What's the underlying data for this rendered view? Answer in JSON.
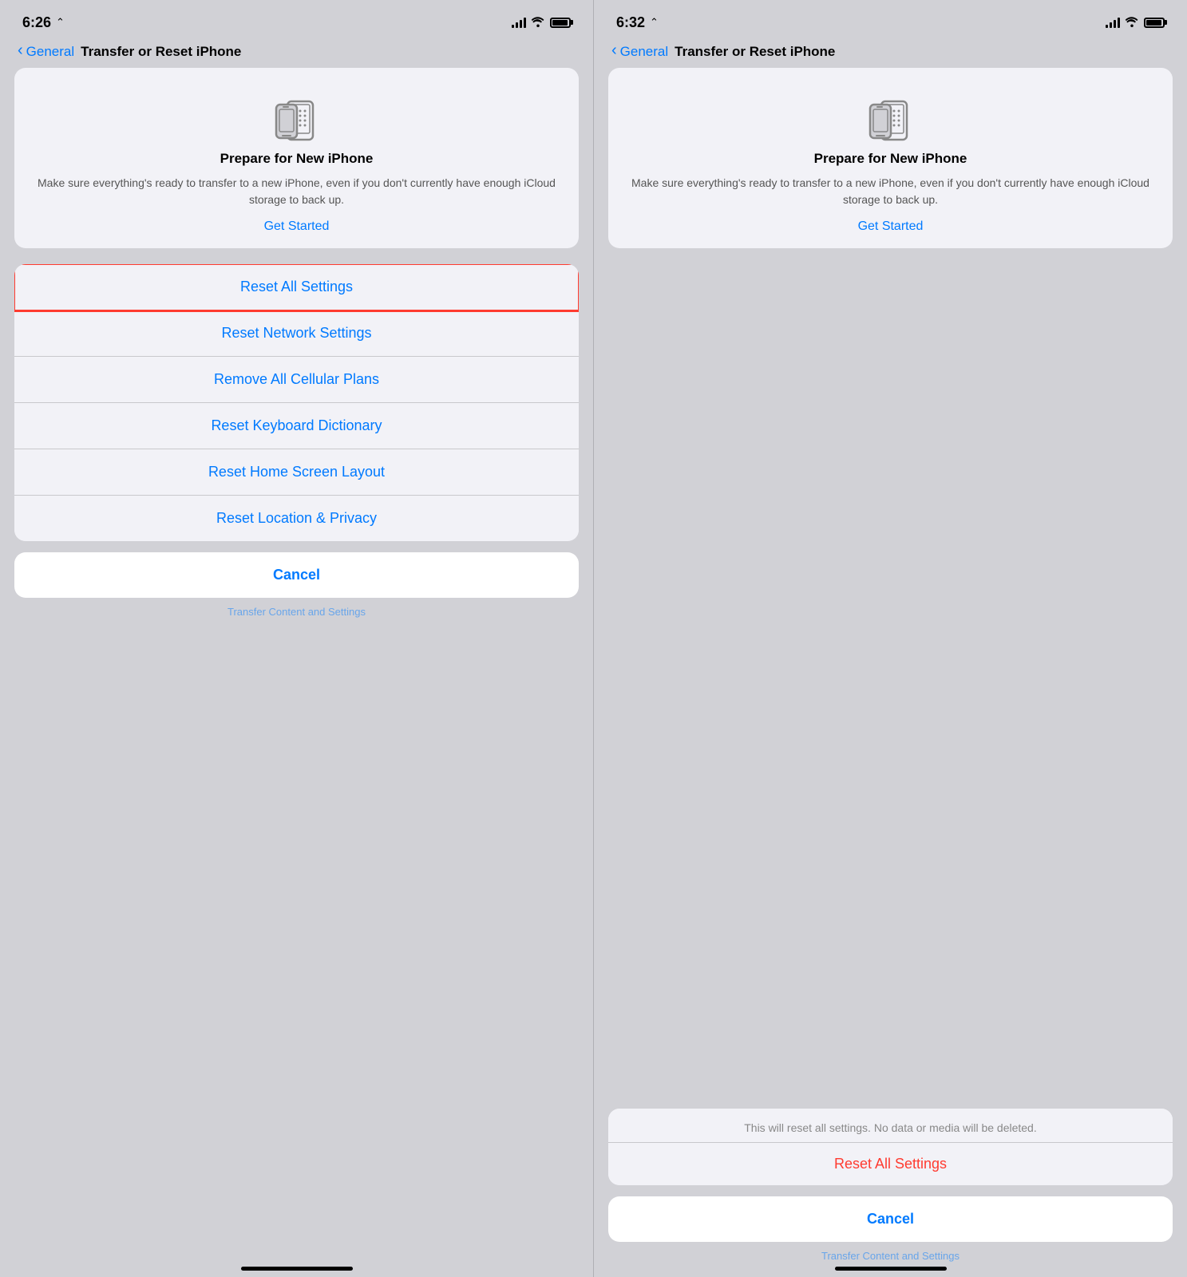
{
  "left_panel": {
    "status": {
      "time": "6:26",
      "location_icon": "◂",
      "signal": true,
      "wifi": true,
      "battery": true
    },
    "nav": {
      "back_label": "General",
      "title": "Transfer or Reset iPhone"
    },
    "prepare_card": {
      "title": "Prepare for New iPhone",
      "description": "Make sure everything's ready to transfer to a new iPhone, even if you don't currently have enough iCloud storage to back up.",
      "cta": "Get Started"
    },
    "reset_items": [
      {
        "label": "Reset All Settings",
        "highlighted": true
      },
      {
        "label": "Reset Network Settings",
        "highlighted": false
      },
      {
        "label": "Remove All Cellular Plans",
        "highlighted": false
      },
      {
        "label": "Reset Keyboard Dictionary",
        "highlighted": false
      },
      {
        "label": "Reset Home Screen Layout",
        "highlighted": false
      },
      {
        "label": "Reset Location & Privacy",
        "highlighted": false
      }
    ],
    "cancel_label": "Cancel",
    "bottom_fade": "Transfer Content and Settings"
  },
  "right_panel": {
    "status": {
      "time": "6:32",
      "location_icon": "◂",
      "signal": true,
      "wifi": true,
      "battery": true
    },
    "nav": {
      "back_label": "General",
      "title": "Transfer or Reset iPhone"
    },
    "prepare_card": {
      "title": "Prepare for New iPhone",
      "description": "Make sure everything's ready to transfer to a new iPhone, even if you don't currently have enough iCloud storage to back up.",
      "cta": "Get Started"
    },
    "confirmation": {
      "description": "This will reset all settings. No data or media will be deleted.",
      "reset_label": "Reset All Settings"
    },
    "cancel_label": "Cancel",
    "bottom_fade": "Transfer Content and Settings"
  }
}
